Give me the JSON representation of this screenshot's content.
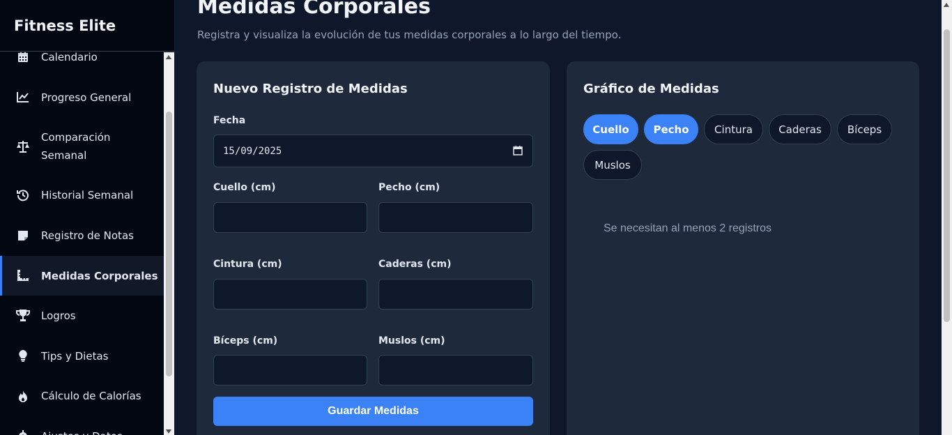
{
  "app": {
    "brand": "Fitness Elite"
  },
  "sidebar": {
    "items": [
      {
        "label": "Calendario",
        "icon": "calendar-icon"
      },
      {
        "label": "Progreso General",
        "icon": "line-chart-icon"
      },
      {
        "label": "Comparación",
        "label2": "Semanal",
        "icon": "scale-icon"
      },
      {
        "label": "Historial Semanal",
        "icon": "history-icon"
      },
      {
        "label": "Registro de Notas",
        "icon": "note-icon"
      },
      {
        "label": "Medidas Corporales",
        "icon": "ruler-icon",
        "active": true
      },
      {
        "label": "Logros",
        "icon": "trophy-icon"
      },
      {
        "label": "Tips y Dietas",
        "icon": "lightbulb-icon"
      },
      {
        "label": "Cálculo de Calorías",
        "icon": "flame-icon"
      },
      {
        "label": "Ajustes y Datos",
        "icon": "gear-icon"
      }
    ]
  },
  "header": {
    "title": "Medidas Corporales",
    "subtitle": "Registra y visualiza la evolución de tus medidas corporales a lo largo del tiempo."
  },
  "form": {
    "title": "Nuevo Registro de Medidas",
    "date_label": "Fecha",
    "date_value": "15/09/2025",
    "fields": [
      {
        "label": "Cuello (cm)",
        "value": ""
      },
      {
        "label": "Pecho (cm)",
        "value": ""
      },
      {
        "label": "Cintura (cm)",
        "value": ""
      },
      {
        "label": "Caderas (cm)",
        "value": ""
      },
      {
        "label": "Bíceps (cm)",
        "value": ""
      },
      {
        "label": "Muslos (cm)",
        "value": ""
      }
    ],
    "save_label": "Guardar Medidas"
  },
  "chart": {
    "title": "Gráfico de Medidas",
    "toggles": [
      {
        "label": "Cuello",
        "active": true
      },
      {
        "label": "Pecho",
        "active": true
      },
      {
        "label": "Cintura",
        "active": false
      },
      {
        "label": "Caderas",
        "active": false
      },
      {
        "label": "Bíceps",
        "active": false
      },
      {
        "label": "Muslos",
        "active": false
      }
    ],
    "empty_message": "Se necesitan al menos 2 registros"
  },
  "colors": {
    "accent": "#3b82f6",
    "background": "#0f172a",
    "card": "#1e293b",
    "sidebar": "#030712"
  }
}
